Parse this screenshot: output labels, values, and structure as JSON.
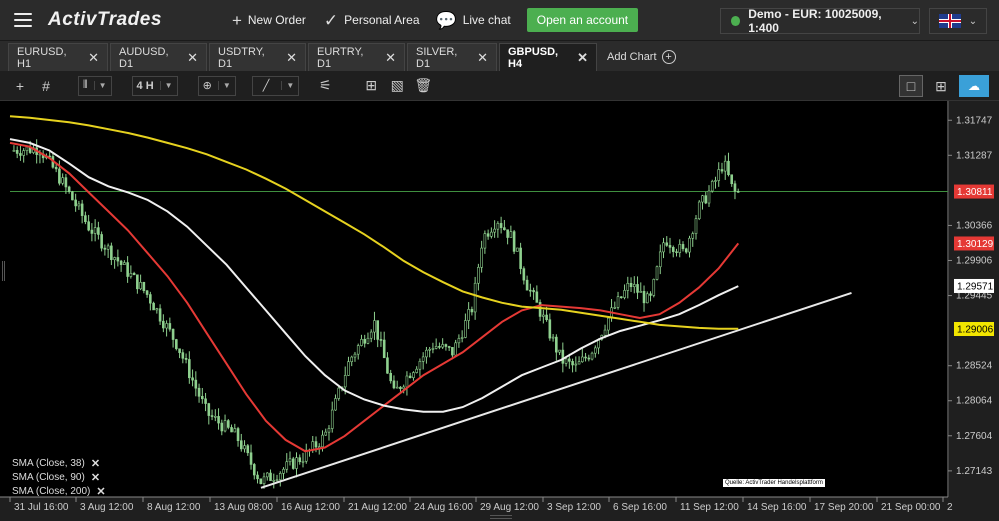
{
  "header": {
    "logo": "ActivTrades",
    "new_order": "New Order",
    "personal_area": "Personal Area",
    "live_chat": "Live chat",
    "open_account": "Open an account",
    "account": "Demo - EUR: 10025009, 1:400"
  },
  "tabs": [
    {
      "label": "EURUSD, H1"
    },
    {
      "label": "AUDUSD, D1"
    },
    {
      "label": "USDTRY, D1"
    },
    {
      "label": "EURTRY, D1"
    },
    {
      "label": "SILVER, D1"
    },
    {
      "label": "GBPUSD, H4",
      "active": true
    }
  ],
  "add_chart": "Add Chart",
  "toolbar": {
    "timeframe": "4 H"
  },
  "icons": {
    "menu": "menu-icon",
    "new_order": "plus-icon",
    "personal_area": "check-icon",
    "live_chat": "chat-icon",
    "status": "online-dot-icon",
    "flag": "uk-flag-icon",
    "crosshair": "crosshair-icon",
    "grid": "grid-icon",
    "candles": "candlestick-icon",
    "indicator": "indicator-icon",
    "line": "line-tool-icon",
    "fib": "fibonacci-icon",
    "layout": "layout-icon",
    "template": "template-icon",
    "trash": "trash-icon",
    "single": "single-chart-icon",
    "multi": "multi-chart-icon",
    "cloud": "cloud-icon"
  },
  "colors": {
    "sma38": "#e53935",
    "sma90": "#f0f0f0",
    "sma200": "#e6d21f",
    "candles": "#8fd18f",
    "trendline": "#e8e8e8",
    "current_line": "#3f8f3f",
    "accent_green": "#4caf50"
  },
  "chart_data": {
    "type": "line",
    "symbol": "GBPUSD",
    "timeframe": "H4",
    "y_ticks": [
      "1.31747",
      "1.31287",
      "1.30366",
      "1.29906",
      "1.29445",
      "1.28524",
      "1.28064",
      "1.27604",
      "1.27143"
    ],
    "y_tick_values": [
      1.31747,
      1.31287,
      1.30366,
      1.29906,
      1.29445,
      1.28524,
      1.28064,
      1.27604,
      1.27143
    ],
    "ylim": [
      1.268,
      1.32
    ],
    "x_ticks": [
      "31 Jul 16:00",
      "3 Aug 12:00",
      "8 Aug 12:00",
      "13 Aug 08:00",
      "16 Aug 12:00",
      "21 Aug 12:00",
      "24 Aug 16:00",
      "29 Aug 12:00",
      "3 Sep 12:00",
      "6 Sep 16:00",
      "11 Sep 12:00",
      "14 Sep 16:00",
      "17 Sep 20:00",
      "21 Sep 00:00",
      "2"
    ],
    "current_price": "1.30811",
    "current_value": 1.30811,
    "price_labels": [
      {
        "text": "1.30811",
        "value": 1.30811,
        "bg": "#e53935",
        "fg": "#ffffff"
      },
      {
        "text": "1.30129",
        "value": 1.30129,
        "bg": "#e53935",
        "fg": "#ffffff"
      },
      {
        "text": "1.29571",
        "value": 1.29571,
        "bg": "#ffffff",
        "fg": "#000000"
      },
      {
        "text": "1.29006",
        "value": 1.29006,
        "bg": "#f3e600",
        "fg": "#000000"
      }
    ],
    "series": [
      {
        "name": "SMA (Close, 38)",
        "color": "#e53935",
        "x": [
          0,
          20,
          40,
          60,
          80,
          100,
          120,
          140,
          160,
          180,
          200,
          220,
          240,
          260,
          280,
          300,
          320,
          340,
          360,
          380,
          400,
          420,
          440,
          460,
          480,
          500,
          520,
          540,
          560,
          580,
          600,
          620,
          640,
          660,
          680,
          700,
          720,
          740
        ],
        "y": [
          1.3145,
          1.314,
          1.3125,
          1.3105,
          1.308,
          1.3055,
          1.303,
          1.3,
          1.297,
          1.2935,
          1.2895,
          1.2855,
          1.2815,
          1.278,
          1.2755,
          1.274,
          1.2745,
          1.276,
          1.278,
          1.28,
          1.282,
          1.284,
          1.2855,
          1.287,
          1.289,
          1.291,
          1.2925,
          1.2932,
          1.293,
          1.2928,
          1.2925,
          1.292,
          1.2915,
          1.292,
          1.2935,
          1.2955,
          1.298,
          1.3013
        ]
      },
      {
        "name": "SMA (Close, 90)",
        "color": "#f0f0f0",
        "x": [
          0,
          20,
          40,
          60,
          80,
          100,
          120,
          140,
          160,
          180,
          200,
          220,
          240,
          260,
          280,
          300,
          320,
          340,
          360,
          380,
          400,
          420,
          440,
          460,
          480,
          500,
          520,
          540,
          560,
          580,
          600,
          620,
          640,
          660,
          680,
          700,
          720,
          740
        ],
        "y": [
          1.315,
          1.3145,
          1.3135,
          1.3118,
          1.31,
          1.3088,
          1.308,
          1.307,
          1.3055,
          1.3035,
          1.301,
          1.2985,
          1.2955,
          1.2925,
          1.2895,
          1.2865,
          1.284,
          1.282,
          1.2808,
          1.28,
          1.2795,
          1.2792,
          1.2792,
          1.2798,
          1.281,
          1.2825,
          1.284,
          1.285,
          1.286,
          1.2875,
          1.2888,
          1.2898,
          1.2905,
          1.2912,
          1.292,
          1.2932,
          1.2945,
          1.2957
        ]
      },
      {
        "name": "SMA (Close, 200)",
        "color": "#e6d21f",
        "x": [
          0,
          20,
          40,
          60,
          80,
          100,
          120,
          140,
          160,
          180,
          200,
          220,
          240,
          260,
          280,
          300,
          320,
          340,
          360,
          380,
          400,
          420,
          440,
          460,
          480,
          500,
          520,
          540,
          560,
          580,
          600,
          620,
          640,
          660,
          680,
          700,
          720,
          740
        ],
        "y": [
          1.318,
          1.3178,
          1.3175,
          1.3172,
          1.3168,
          1.3163,
          1.3158,
          1.3152,
          1.3145,
          1.3138,
          1.313,
          1.312,
          1.311,
          1.3098,
          1.3085,
          1.307,
          1.3055,
          1.304,
          1.3025,
          1.3008,
          1.299,
          1.2975,
          1.2962,
          1.295,
          1.2942,
          1.2935,
          1.293,
          1.2928,
          1.2926,
          1.2922,
          1.2918,
          1.2914,
          1.291,
          1.2906,
          1.2904,
          1.2902,
          1.2901,
          1.2901
        ]
      }
    ],
    "trendline": {
      "x": [
        255,
        855
      ],
      "y": [
        1.2692,
        1.2948
      ]
    }
  },
  "legend": [
    "SMA (Close, 38)",
    "SMA (Close, 90)",
    "SMA (Close, 200)"
  ],
  "source": "Quelle: ActivTrader Handelsplattform"
}
